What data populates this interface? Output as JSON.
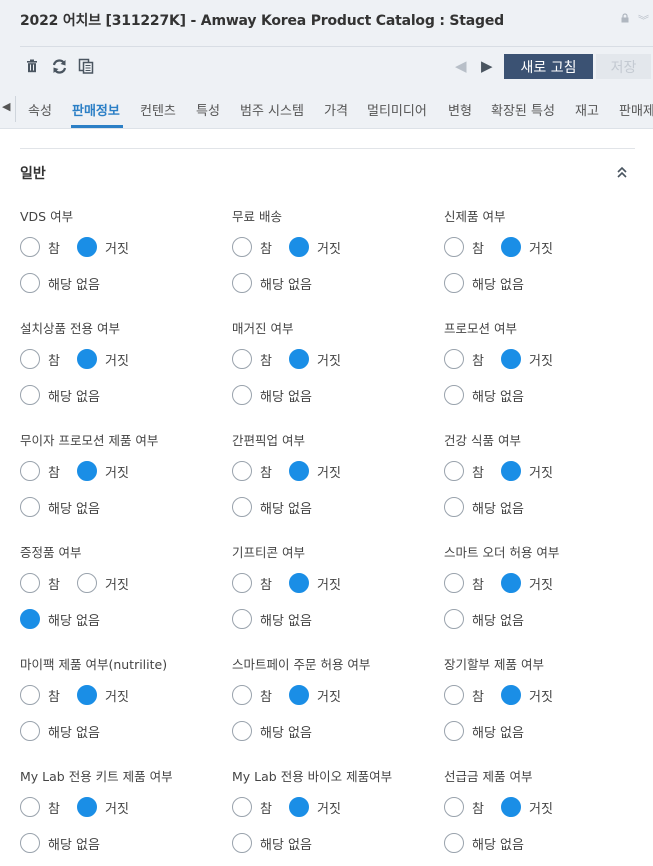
{
  "header": {
    "title": "2022 어치브 [311227K] - Amway Korea Product Catalog : Staged",
    "refresh_label": "새로 고침",
    "save_label": "저장"
  },
  "tabs": [
    "속성",
    "판매정보",
    "컨텐츠",
    "특성",
    "범주 시스템",
    "가격",
    "멀티미디어",
    "변형",
    "확장된 특성",
    "재고",
    "판매제"
  ],
  "active_tab": "판매정보",
  "section": {
    "title": "일반"
  },
  "options": {
    "true": "참",
    "false": "거짓",
    "na": "해당 없음"
  },
  "fields": [
    {
      "label": "VDS 여부",
      "value": "false"
    },
    {
      "label": "무료 배송",
      "value": "false"
    },
    {
      "label": "신제품 여부",
      "value": "false"
    },
    {
      "label": "설치상품 전용 여부",
      "value": "false"
    },
    {
      "label": "매거진 여부",
      "value": "false"
    },
    {
      "label": "프로모션 여부",
      "value": "false"
    },
    {
      "label": "무이자 프로모션 제품 여부",
      "value": "false"
    },
    {
      "label": "간편픽업 여부",
      "value": "false"
    },
    {
      "label": "건강 식품 여부",
      "value": "false"
    },
    {
      "label": "증정품 여부",
      "value": "na"
    },
    {
      "label": "기프티콘 여부",
      "value": "false"
    },
    {
      "label": "스마트 오더 허용 여부",
      "value": "false"
    },
    {
      "label": "마이팩 제품 여부(nutrilite)",
      "value": "false"
    },
    {
      "label": "스마트페이 주문 허용 여부",
      "value": "false"
    },
    {
      "label": "장기할부 제품 여부",
      "value": "false"
    },
    {
      "label": "My Lab 전용 키트 제품 여부",
      "value": "false"
    },
    {
      "label": "My Lab 전용 바이오 제품여부",
      "value": "false"
    },
    {
      "label": "선급금 제품 여부",
      "value": "false"
    }
  ]
}
